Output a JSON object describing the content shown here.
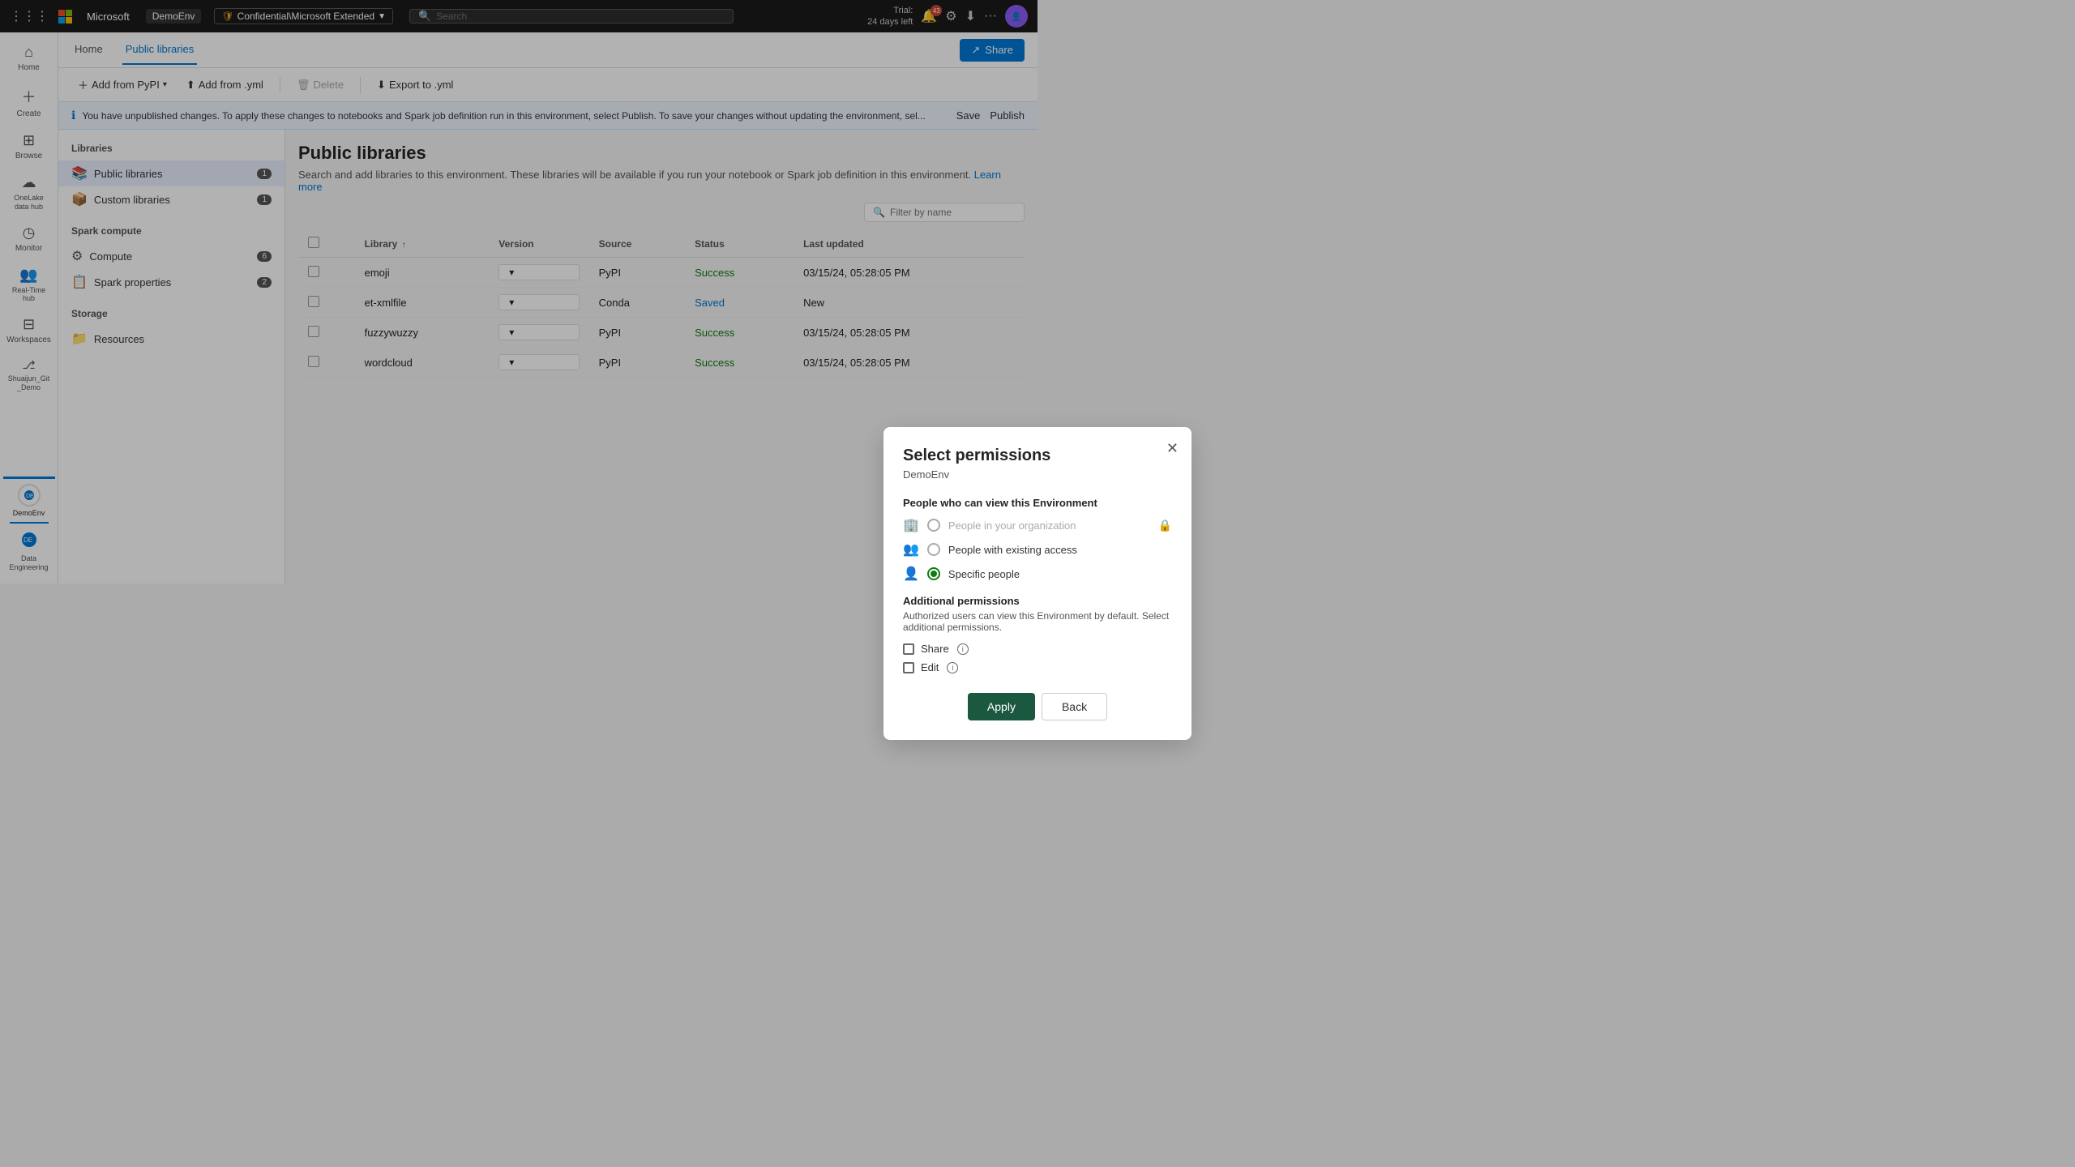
{
  "topbar": {
    "grid_icon": "⋮⋮⋮",
    "brand": "Microsoft",
    "env": "DemoEnv",
    "workspace_label": "Confidential\\Microsoft Extended",
    "search_placeholder": "Search",
    "trial_line1": "Trial:",
    "trial_line2": "24 days left",
    "notif_count": "43",
    "more_icon": "···"
  },
  "nav": {
    "tabs": [
      "Home",
      "Public libraries"
    ],
    "active_tab": "Public libraries",
    "share_label": "Share"
  },
  "toolbar": {
    "add_from_pypi": "Add from PyPI",
    "add_from_yml": "Add from .yml",
    "delete": "Delete",
    "export_to_yml": "Export to .yml"
  },
  "infobar": {
    "message": "You have unpublished changes. To apply these changes to notebooks and Spark job definition run in this environment, select Publish. To save your changes without updating the environment, sel...",
    "save_label": "Save",
    "publish_label": "Publish"
  },
  "left_panel": {
    "libraries_title": "Libraries",
    "items": [
      {
        "id": "public-libraries",
        "label": "Public libraries",
        "badge": "1",
        "icon": "📚"
      },
      {
        "id": "custom-libraries",
        "label": "Custom libraries",
        "badge": "1",
        "icon": "📦"
      }
    ],
    "spark_compute_title": "Spark compute",
    "spark_items": [
      {
        "id": "compute",
        "label": "Compute",
        "badge": "6",
        "icon": "⚙"
      },
      {
        "id": "spark-properties",
        "label": "Spark properties",
        "badge": "2",
        "icon": "📋"
      }
    ],
    "storage_title": "Storage",
    "storage_items": [
      {
        "id": "resources",
        "label": "Resources",
        "badge": "",
        "icon": "📁"
      }
    ]
  },
  "main_content": {
    "title": "Public libraries",
    "description": "Search and add libraries to this environment. These libraries will be available if you run your notebook or Spark job definition in this environment.",
    "learn_more": "Learn more",
    "filter_placeholder": "Filter by name",
    "table": {
      "columns": [
        "",
        "Library",
        "Version",
        "Source",
        "Status",
        "Last updated"
      ],
      "rows": [
        {
          "name": "emoji",
          "version": "",
          "source": "PyPI",
          "status": "Success",
          "last_updated": "03/15/24, 05:28:05 PM"
        },
        {
          "name": "et-xmlfile",
          "version": "",
          "source": "Conda",
          "status": "Saved",
          "last_updated": "New"
        },
        {
          "name": "fuzzywuzzy",
          "version": "",
          "source": "PyPI",
          "status": "Success",
          "last_updated": "03/15/24, 05:28:05 PM"
        },
        {
          "name": "wordcloud",
          "version": "",
          "source": "PyPI",
          "status": "Success",
          "last_updated": "03/15/24, 05:28:05 PM"
        }
      ]
    }
  },
  "sidebar_nav": [
    {
      "id": "home",
      "label": "Home",
      "icon": "⌂"
    },
    {
      "id": "create",
      "label": "Create",
      "icon": "+"
    },
    {
      "id": "browse",
      "label": "Browse",
      "icon": "⊞"
    },
    {
      "id": "onelake",
      "label": "OneLake data hub",
      "icon": "☁"
    },
    {
      "id": "monitor",
      "label": "Monitor",
      "icon": "◷"
    },
    {
      "id": "realtime",
      "label": "Real-Time hub",
      "icon": "👥"
    },
    {
      "id": "workspaces",
      "label": "Workspaces",
      "icon": "⊟"
    },
    {
      "id": "shuaijun",
      "label": "Shuaijun_Git _Demo",
      "icon": "⎇"
    }
  ],
  "sidebar_bottom": {
    "label": "DemoEnv",
    "icon": "⬡"
  },
  "modal": {
    "title": "Select permissions",
    "subtitle": "DemoEnv",
    "close_icon": "✕",
    "view_section_title": "People who can view this Environment",
    "view_options": [
      {
        "id": "org",
        "label": "People in your organization",
        "checked": false,
        "disabled": true
      },
      {
        "id": "existing",
        "label": "People with existing access",
        "checked": false,
        "disabled": false
      },
      {
        "id": "specific",
        "label": "Specific people",
        "checked": true,
        "disabled": false
      }
    ],
    "additional_title": "Additional permissions",
    "additional_desc": "Authorized users can view this Environment by default. Select additional permissions.",
    "checkboxes": [
      {
        "id": "share",
        "label": "Share",
        "checked": false
      },
      {
        "id": "edit",
        "label": "Edit",
        "checked": false
      }
    ],
    "apply_label": "Apply",
    "back_label": "Back"
  }
}
